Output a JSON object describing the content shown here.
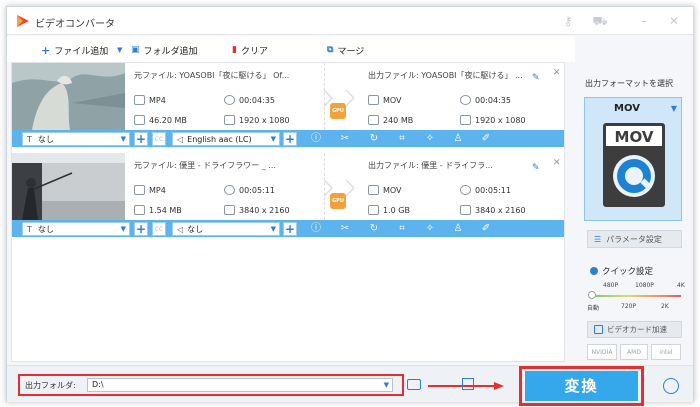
{
  "app": {
    "title": "ビデオコンバータ"
  },
  "toolbar": {
    "add_file": "ファイル追加",
    "add_folder": "フォルダ追加",
    "clear": "クリア",
    "merge": "マージ"
  },
  "files": [
    {
      "source_title": "元ファイル: YOASOBI「夜に駆ける」 Of...",
      "source_format": "MP4",
      "source_duration": "00:04:35",
      "source_size": "46.20 MB",
      "source_resolution": "1920 x 1080",
      "output_title": "出力ファイル: YOASOBI「夜に駆ける」 ...",
      "output_format": "MOV",
      "output_duration": "00:04:35",
      "output_size": "240 MB",
      "output_resolution": "1920 x 1080",
      "gpu_label": "GPU",
      "subtitle": "なし",
      "audio": "English aac (LC)",
      "cc": "CC"
    },
    {
      "source_title": "元ファイル: 優里 - ドライフラワー _ ...",
      "source_format": "MP4",
      "source_duration": "00:05:11",
      "source_size": "1.54 MB",
      "source_resolution": "3840 x 2160",
      "output_title": "出力ファイル: 優里 - ドライフラ...",
      "output_format": "MOV",
      "output_duration": "00:05:11",
      "output_size": "1.0 GB",
      "output_resolution": "3840 x 2160",
      "gpu_label": "GPU",
      "subtitle": "なし",
      "audio": "なし",
      "cc": "CC"
    }
  ],
  "right_panel": {
    "select_format_label": "出力フォーマットを選択",
    "format": "MOV",
    "format_icon_text": "MOV",
    "param_settings": "パラメータ設定",
    "quick_settings": "クイック設定",
    "quality_top": [
      "480P",
      "1080P",
      "4K"
    ],
    "quality_bottom": [
      "自動",
      "720P",
      "2K"
    ],
    "gpu_accel": "ビデオカード加速",
    "vendors": [
      "NVIDIA",
      "AMD",
      "intel"
    ]
  },
  "bottom": {
    "output_folder_label": "出力フォルダ:",
    "output_folder_value": "D:\\",
    "convert_label": "変換"
  },
  "colors": {
    "accent": "#35a8ec",
    "bar": "#5cb3ee",
    "highlight": "#e23030",
    "gpu": "#f2a23a"
  }
}
